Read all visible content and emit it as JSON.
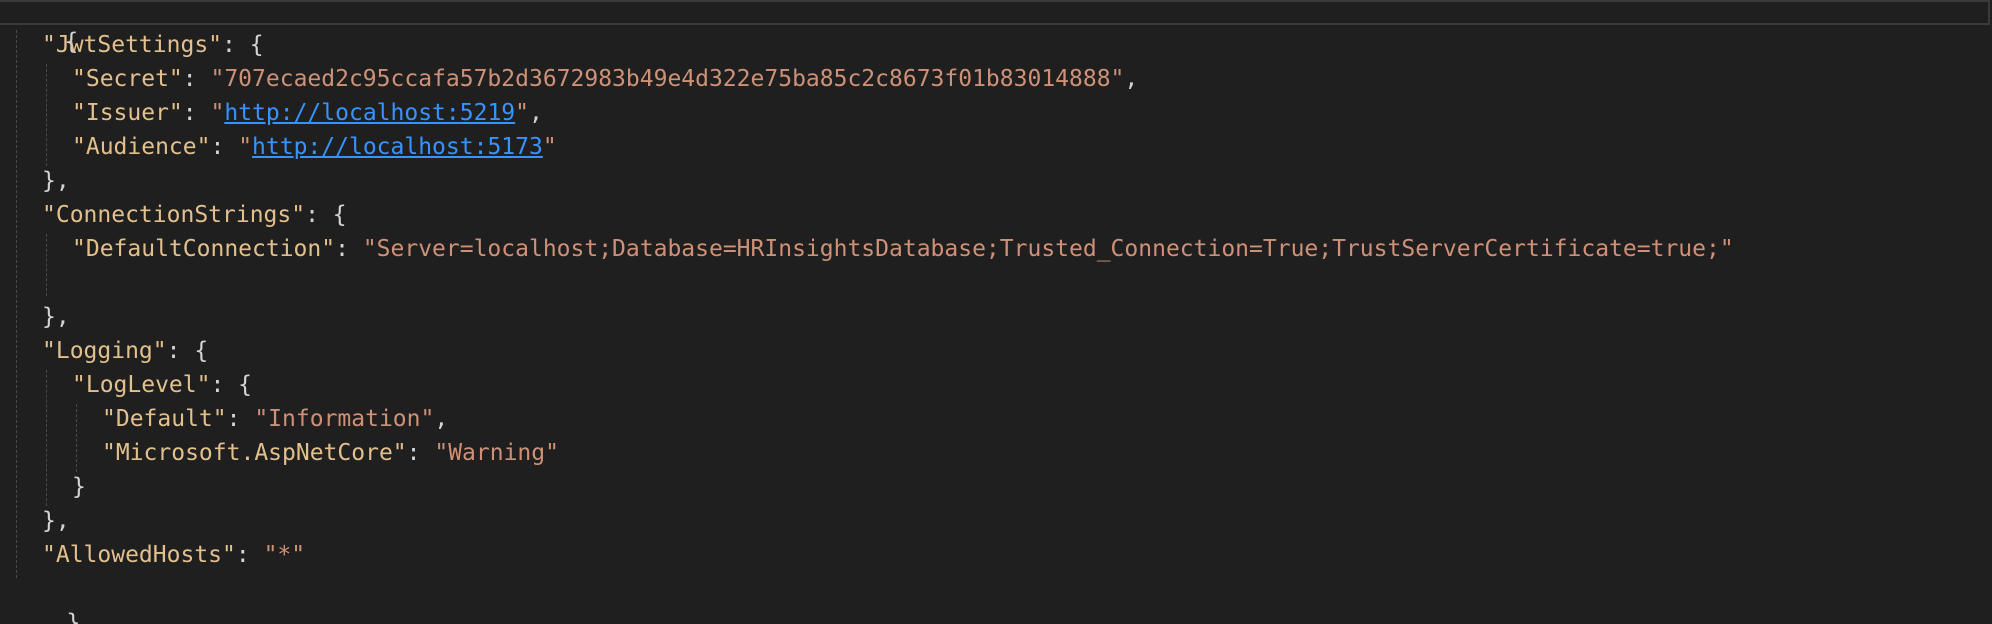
{
  "editor": {
    "open_root": "{",
    "close_root": "}",
    "jwt": {
      "key": "\"JwtSettings\"",
      "secret_key": "\"Secret\"",
      "secret_value": "\"707ecaed2c95ccafa57b2d3672983b49e4d322e75ba85c2c8673f01b83014888\"",
      "issuer_key": "\"Issuer\"",
      "issuer_url": "http://localhost:5219",
      "audience_key": "\"Audience\"",
      "audience_url": "http://localhost:5173"
    },
    "connection": {
      "key": "\"ConnectionStrings\"",
      "default_key": "\"DefaultConnection\"",
      "default_value": "\"Server=localhost;Database=HRInsightsDatabase;Trusted_Connection=True;TrustServerCertificate=true;\""
    },
    "logging": {
      "key": "\"Logging\"",
      "loglevel_key": "\"LogLevel\"",
      "default_key": "\"Default\"",
      "default_value": "\"Information\"",
      "aspnet_key": "\"Microsoft.AspNetCore\"",
      "aspnet_value": "\"Warning\""
    },
    "allowed": {
      "key": "\"AllowedHosts\"",
      "value": "\"*\""
    }
  },
  "colors": {
    "background": "#1f1f1f",
    "key": "#e2c08d",
    "string": "#ce9178",
    "link": "#3794ff",
    "punctuation": "#d4d4d4"
  }
}
